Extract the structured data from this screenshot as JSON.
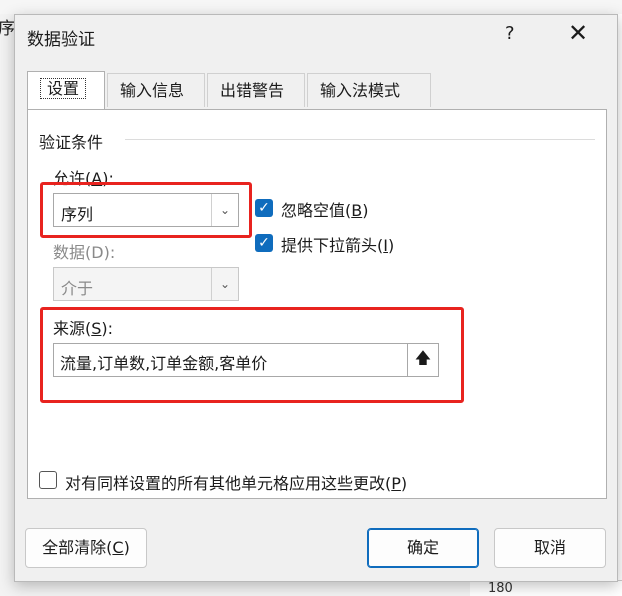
{
  "background": {
    "partial_char": "序",
    "row_value": "180"
  },
  "dialog": {
    "title": "数据验证",
    "help_label": "?",
    "close_label": "✕"
  },
  "tabs": [
    {
      "label": "设置",
      "active": true
    },
    {
      "label": "输入信息",
      "active": false
    },
    {
      "label": "出错警告",
      "active": false
    },
    {
      "label": "输入法模式",
      "active": false
    }
  ],
  "settings": {
    "section_title": "验证条件",
    "allow": {
      "label": "允许",
      "key": "A",
      "value": "序列"
    },
    "data": {
      "label": "数据",
      "key": "D",
      "value": "介于",
      "disabled": true
    },
    "ignore_blank": {
      "label": "忽略空值",
      "key": "B",
      "checked": true
    },
    "dropdown_arrow": {
      "label": "提供下拉箭头",
      "key": "I",
      "checked": true
    },
    "source": {
      "label": "来源",
      "key": "S",
      "value": "流量,订单数,订单金额,客单价"
    },
    "apply_all": {
      "label": "对有同样设置的所有其他单元格应用这些更改",
      "key": "P",
      "checked": false
    }
  },
  "buttons": {
    "clear_all": {
      "label": "全部清除",
      "key": "C"
    },
    "ok": "确定",
    "cancel": "取消"
  },
  "highlight_color": "#e8231f",
  "accent_color": "#0f6cbd"
}
